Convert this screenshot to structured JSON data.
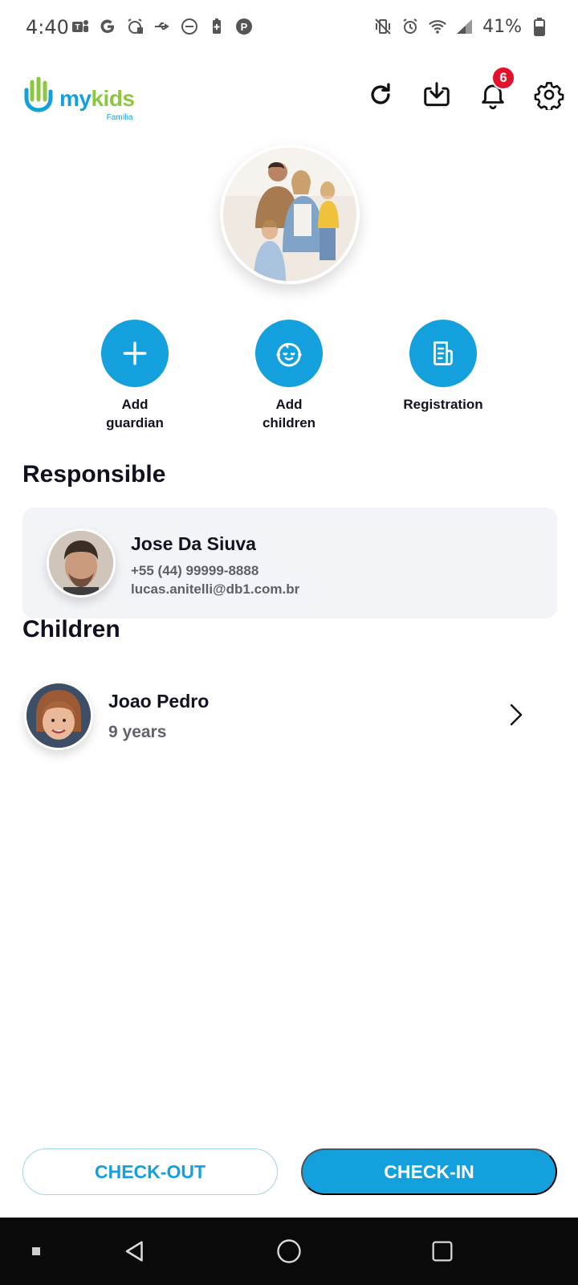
{
  "status_bar": {
    "time": "4:40",
    "battery": "41%",
    "left_icons": [
      "teams-icon",
      "google-icon",
      "alarm-snooze-icon",
      "usb-icon",
      "do-not-disturb-icon",
      "battery-saver-icon",
      "p-app-icon"
    ],
    "right_icons": [
      "vibrate-off-icon",
      "alarm-icon",
      "wifi-icon",
      "signal-icon",
      "battery-icon"
    ]
  },
  "header": {
    "logo_my": "my",
    "logo_kids": "kids",
    "logo_sub": "Família",
    "notification_count": "6"
  },
  "quick_actions": [
    {
      "label": "Add\nguardian",
      "icon": "plus-icon"
    },
    {
      "label": "Add\nchildren",
      "icon": "baby-face-icon"
    },
    {
      "label": "Registration",
      "icon": "document-icon"
    }
  ],
  "responsible": {
    "title": "Responsible",
    "name": "Jose Da Siuva",
    "phone": "+55 (44) 99999-8888",
    "email": "lucas.anitelli@db1.com.br"
  },
  "children": {
    "title": "Children",
    "items": [
      {
        "name": "Joao Pedro",
        "age": "9 years"
      }
    ]
  },
  "buttons": {
    "checkout": "CHECK-OUT",
    "checkin": "CHECK-IN"
  },
  "colors": {
    "primary": "#13a0dd",
    "accent_green": "#8dc63f",
    "badge_red": "#e3112c",
    "card_bg": "#f3f4f8"
  }
}
